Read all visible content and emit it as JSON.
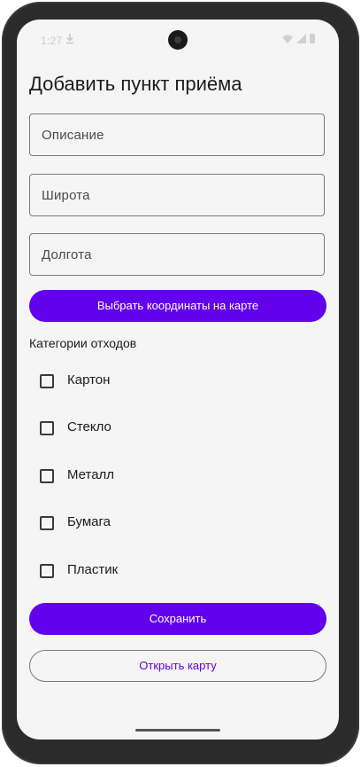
{
  "status_bar": {
    "time": "1:27"
  },
  "title": "Добавить пункт приёма",
  "fields": [
    {
      "placeholder": "Описание"
    },
    {
      "placeholder": "Широта"
    },
    {
      "placeholder": "Долгота"
    }
  ],
  "pick_coordinates_button": "Выбрать координаты на карте",
  "categories_label": "Категории отходов",
  "categories": [
    {
      "label": "Картон",
      "checked": false
    },
    {
      "label": "Стекло",
      "checked": false
    },
    {
      "label": "Металл",
      "checked": false
    },
    {
      "label": "Бумага",
      "checked": false
    },
    {
      "label": "Пластик",
      "checked": false
    }
  ],
  "save_button": "Сохранить",
  "open_map_button": "Открыть карту",
  "colors": {
    "accent": "#6200ee",
    "background": "#f5f5f5",
    "frame": "#2b2b2b"
  },
  "icons": [
    "download-icon",
    "wifi-icon",
    "signal-icon",
    "battery-icon"
  ]
}
